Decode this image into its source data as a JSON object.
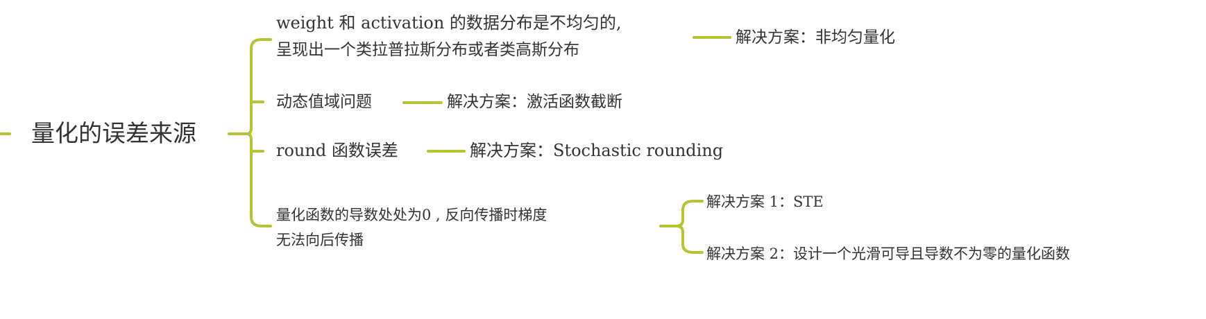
{
  "mindmap": {
    "accent_color": "#b5c334",
    "text_color": "#333333",
    "root": {
      "label": "量化的误差来源"
    },
    "branches": [
      {
        "lines": [
          "weight 和 activation 的数据分布是不均匀的,",
          "呈现出一个类拉普拉斯分布或者类高斯分布"
        ],
        "solutions": [
          "解决方案：非均匀量化"
        ]
      },
      {
        "lines": [
          "动态值域问题"
        ],
        "solutions": [
          "解决方案：激活函数截断"
        ]
      },
      {
        "lines": [
          "round 函数误差"
        ],
        "solutions": [
          "解决方案：Stochastic rounding"
        ]
      },
      {
        "lines": [
          "量化函数的导数处处为0 , 反向传播时梯度",
          "无法向后传播"
        ],
        "solutions": [
          "解决方案 1：STE",
          "解决方案 2：设计一个光滑可导且导数不为零的量化函数"
        ]
      }
    ]
  }
}
